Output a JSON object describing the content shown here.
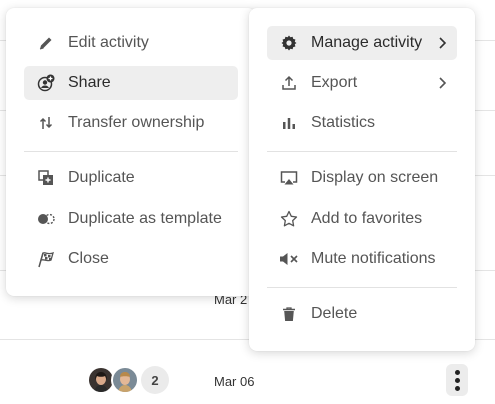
{
  "left_menu": {
    "items": [
      {
        "label": "Edit activity",
        "icon": "pencil-icon"
      },
      {
        "label": "Share",
        "icon": "share-user-icon"
      },
      {
        "label": "Transfer ownership",
        "icon": "transfer-arrows-icon"
      },
      {
        "label": "Duplicate",
        "icon": "duplicate-icon"
      },
      {
        "label": "Duplicate as template",
        "icon": "template-icon"
      },
      {
        "label": "Close",
        "icon": "checkered-flag-icon"
      }
    ]
  },
  "right_menu": {
    "items": [
      {
        "label": "Manage activity",
        "icon": "gear-icon"
      },
      {
        "label": "Export",
        "icon": "upload-icon"
      },
      {
        "label": "Statistics",
        "icon": "bar-chart-icon"
      },
      {
        "label": "Display on screen",
        "icon": "airplay-icon"
      },
      {
        "label": "Add to favorites",
        "icon": "star-icon"
      },
      {
        "label": "Mute notifications",
        "icon": "mute-icon"
      },
      {
        "label": "Delete",
        "icon": "trash-icon"
      }
    ]
  },
  "list": {
    "row_partial_date": "Mar 2",
    "row_date": "Mar 06",
    "participant_extra_count": "2"
  },
  "colors": {
    "menu_bg": "#ffffff",
    "hover_bg": "#eeeeee",
    "text": "#555555"
  }
}
